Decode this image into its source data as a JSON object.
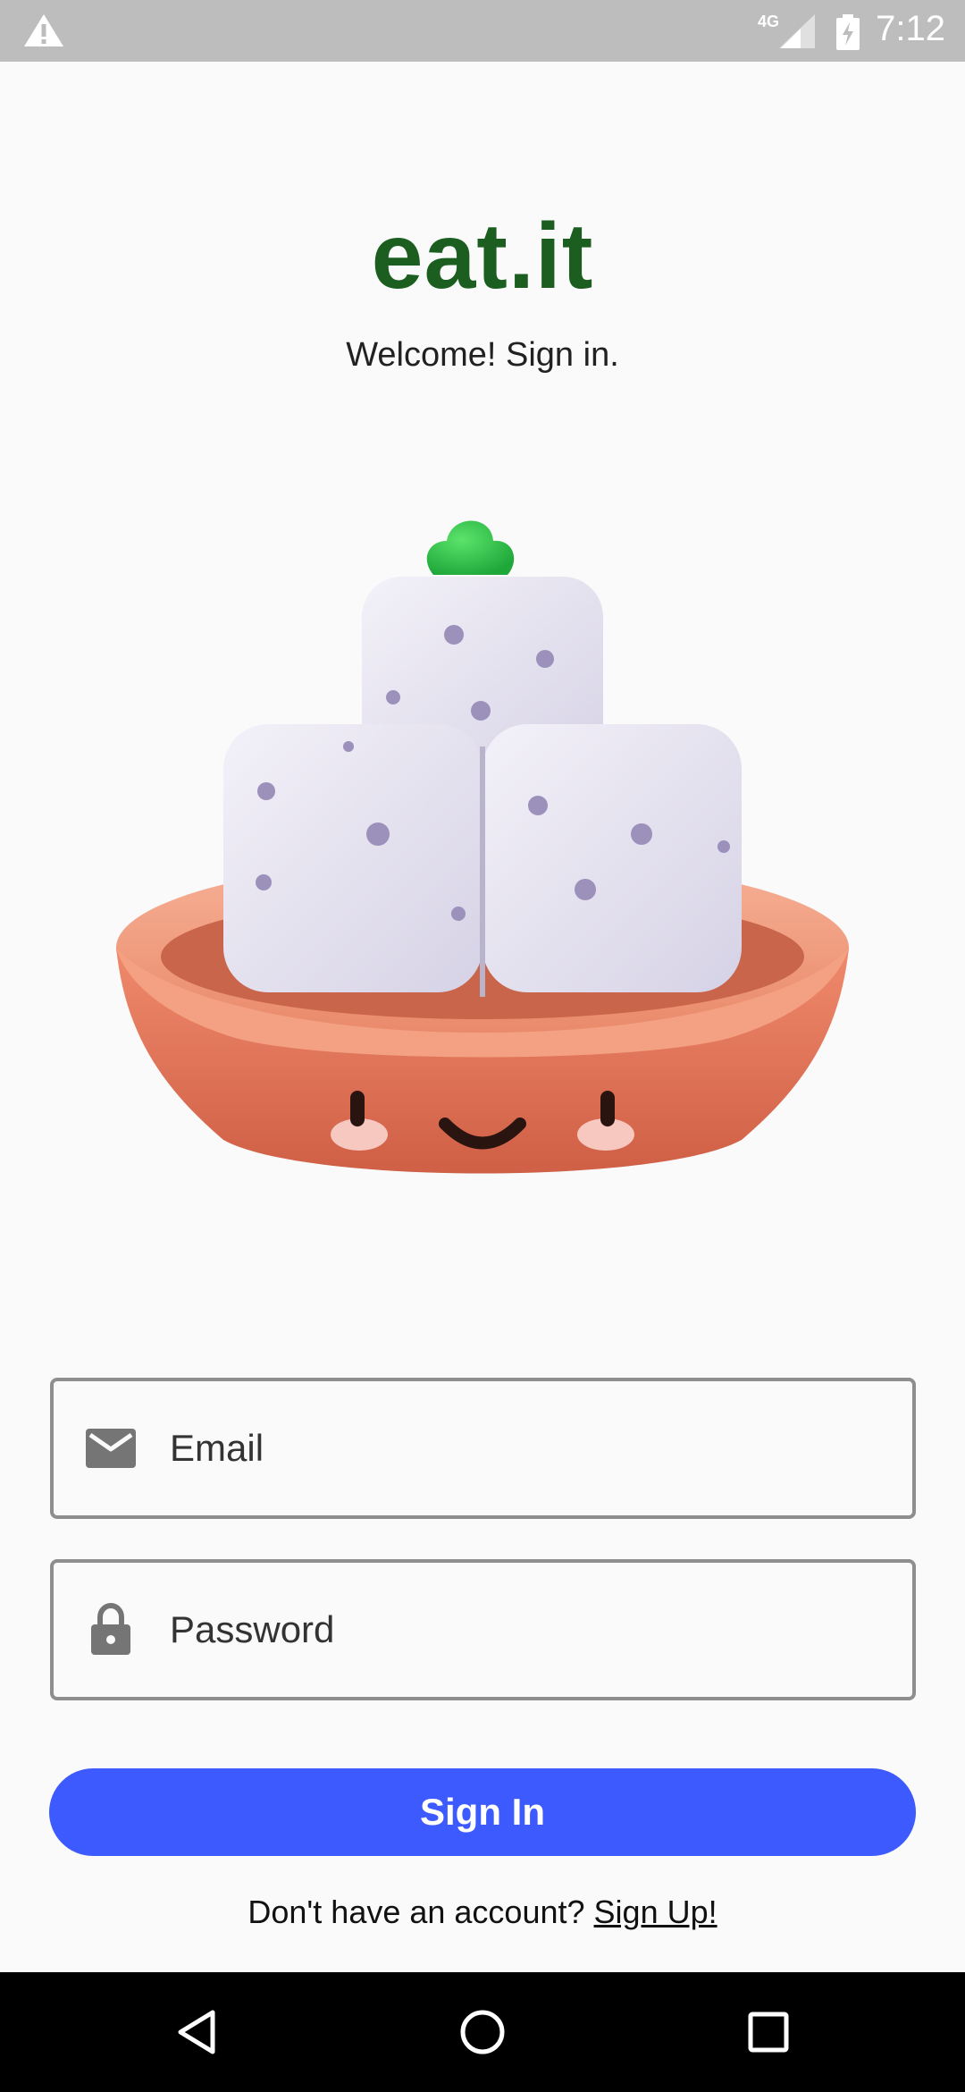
{
  "status_bar": {
    "network_type": "4G",
    "time": "7:12",
    "icons": [
      "warning-icon",
      "signal-icon",
      "battery-charging-icon"
    ]
  },
  "header": {
    "app_title": "eat.it",
    "subtitle": "Welcome! Sign in."
  },
  "form": {
    "email": {
      "placeholder": "Email",
      "value": "",
      "icon": "mail-icon"
    },
    "password": {
      "placeholder": "Password",
      "value": "",
      "icon": "lock-icon"
    },
    "sign_in_label": "Sign In"
  },
  "signup": {
    "prompt": "Don't have an account?",
    "link_label": "Sign Up!"
  },
  "nav_bar": {
    "icons": [
      "back-icon",
      "home-icon",
      "recents-icon"
    ]
  },
  "colors": {
    "title": "#1b5e20",
    "primary_button": "#3d5afe",
    "status_bar": "#bdbdbd",
    "bowl": "#e07a5f"
  }
}
